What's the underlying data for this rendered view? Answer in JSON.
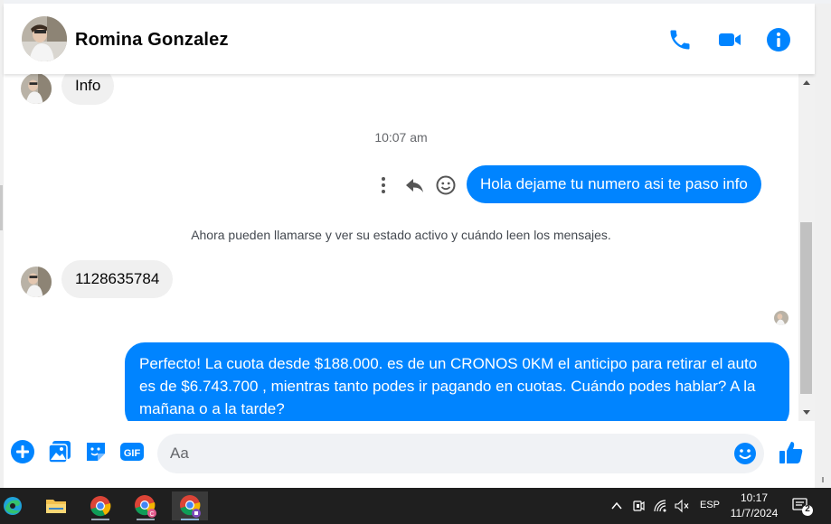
{
  "header": {
    "contact_name": "Romina Gonzalez",
    "icons": [
      "phone-icon",
      "video-camera-icon",
      "info-icon"
    ]
  },
  "conversation": {
    "messages_top": [
      {
        "direction": "in",
        "text": "Info"
      }
    ],
    "timestamp": "10:07 am",
    "outgoing_1": "Hola dejame tu numero asi te paso info",
    "notice": "Ahora pueden llamarse y ver su estado activo y cuándo leen los mensajes.",
    "incoming_phone": "1128635784",
    "outgoing_2": "Perfecto! La cuota desde $188.000. es de un CRONOS 0KM el anticipo para retirar el auto es de $6.743.700 , mientras tanto podes ir pagando en cuotas. Cuándo podes hablar? A la mañana o a la tarde?"
  },
  "composer": {
    "placeholder": "Aa",
    "value": "",
    "gif_label": "GIF",
    "icons": [
      "plus-icon",
      "photo-icon",
      "sticker-icon",
      "gif-icon",
      "emoji-icon",
      "thumbs-up-icon"
    ]
  },
  "taskbar": {
    "apps": [
      "edge-icon",
      "file-explorer-icon",
      "chrome-icon",
      "chrome-profile-icon",
      "chrome-active-icon"
    ],
    "language": "ESP",
    "time": "10:17",
    "date": "11/7/2024",
    "notification_count": "2"
  },
  "colors": {
    "messenger_blue": "#0084ff",
    "incoming_bubble": "#f0f0f0",
    "taskbar": "#1f1f1f"
  }
}
